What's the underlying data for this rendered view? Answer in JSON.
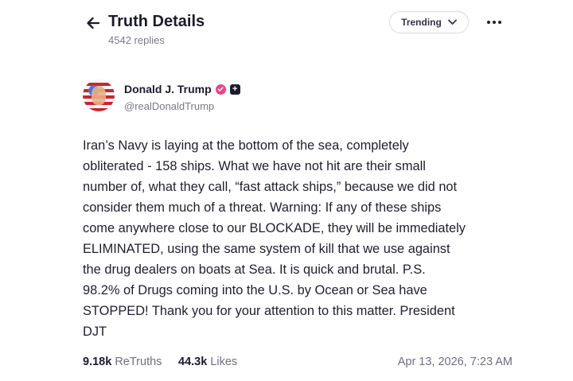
{
  "header": {
    "title": "Truth Details",
    "replies": "4542 replies",
    "sort_label": "Trending"
  },
  "author": {
    "name": "Donald J. Trump",
    "handle": "@realDonaldTrump"
  },
  "post": {
    "text": "Iran’s Navy is laying at the bottom of the sea, completely\nobliterated - 158 ships. What we have not hit are their small\nnumber of, what they call, “fast attack ships,” because we did not\nconsider them much of a threat. Warning: If any of these ships\ncome anywhere close to our BLOCKADE, they will be immediately\nELIMINATED, using the same system of kill that we use against\nthe drug dealers on boats at Sea. It is quick and brutal. P.S.\n98.2% of Drugs coming into the U.S. by Ocean or Sea have\nSTOPPED! Thank you for your attention to this matter. President\nDJT"
  },
  "stats": {
    "retruths_count": "9.18k",
    "retruths_label": "ReTruths",
    "likes_count": "44.3k",
    "likes_label": "Likes",
    "timestamp": "Apr 13, 2026, 7:23 AM"
  },
  "icons": {
    "back": "arrow-left-icon",
    "sort": "chevron-down-icon",
    "more": "more-horizontal-icon",
    "verified": "verified-badge-icon",
    "plus": "plus-badge-icon"
  },
  "colors": {
    "verified_badge": "#e8468a",
    "text_primary": "#1f1f2e",
    "text_secondary": "#7a7a8a"
  }
}
